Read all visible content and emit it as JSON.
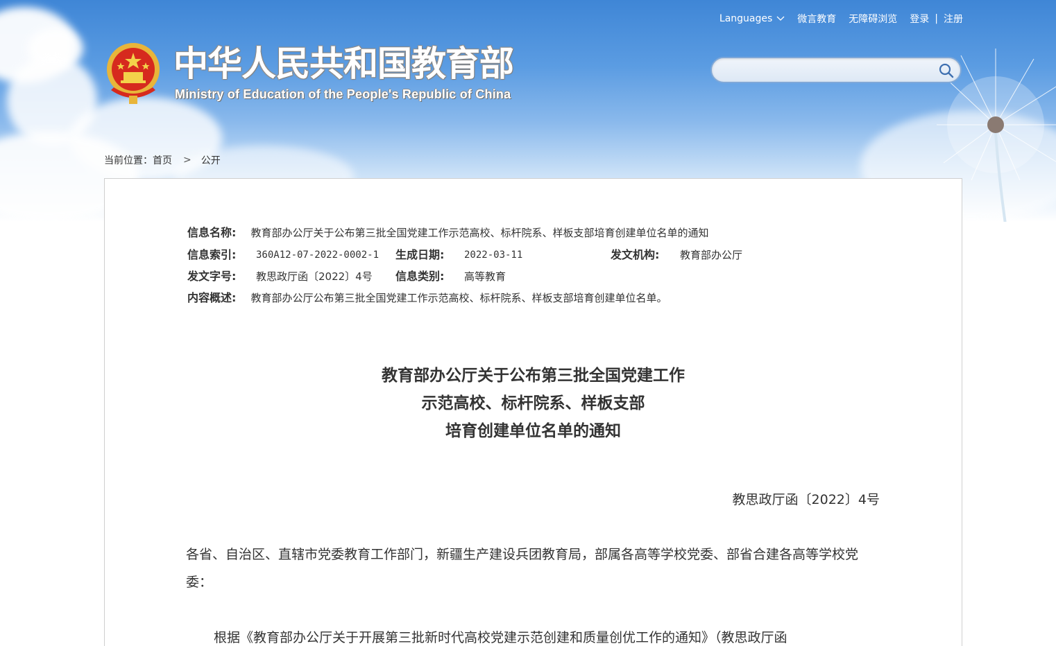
{
  "header": {
    "title_cn": "中华人民共和国教育部",
    "title_en": "Ministry of Education of the People's Republic of China",
    "top_links": {
      "languages": "Languages",
      "weibo": "微言教育",
      "accessibility": "无障碍浏览",
      "login": "登录",
      "separator": "|",
      "register": "注册"
    },
    "search": {
      "value": "",
      "placeholder": ""
    }
  },
  "breadcrumb": {
    "prefix": "当前位置：",
    "home": "首页",
    "arrow": ">",
    "current": "公开"
  },
  "meta": {
    "name_label": "信息名称:",
    "name_value": "教育部办公厅关于公布第三批全国党建工作示范高校、标杆院系、样板支部培育创建单位名单的通知",
    "index_label": "信息索引:",
    "index_value": "360A12-07-2022-0002-1",
    "date_label": "生成日期:",
    "date_value": "2022-03-11",
    "issuer_label": "发文机构:",
    "issuer_value": "教育部办公厅",
    "docno_label": "发文字号:",
    "docno_value": "教思政厅函〔2022〕4号",
    "category_label": "信息类别:",
    "category_value": "高等教育",
    "summary_label": "内容概述:",
    "summary_value": "教育部办公厅公布第三批全国党建工作示范高校、标杆院系、样板支部培育创建单位名单。"
  },
  "document": {
    "title_line1": "教育部办公厅关于公布第三批全国党建工作",
    "title_line2": "示范高校、标杆院系、样板支部",
    "title_line3": "培育创建单位名单的通知",
    "doc_number": "教思政厅函〔2022〕4号",
    "recipients": "各省、自治区、直辖市党委教育工作部门，新疆生产建设兵团教育局，部属各高等学校党委、部省合建各高等学校党委：",
    "body_start": "根据《教育部办公厅关于开展第三批新时代高校党建示范创建和质量创优工作的通知》（教思政厅函"
  }
}
